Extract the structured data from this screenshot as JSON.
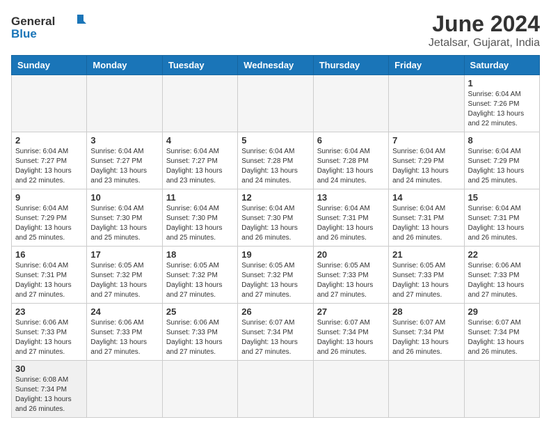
{
  "logo": {
    "general": "General",
    "blue": "Blue"
  },
  "title": "June 2024",
  "subtitle": "Jetalsar, Gujarat, India",
  "days_of_week": [
    "Sunday",
    "Monday",
    "Tuesday",
    "Wednesday",
    "Thursday",
    "Friday",
    "Saturday"
  ],
  "weeks": [
    [
      {
        "day": "",
        "info": ""
      },
      {
        "day": "",
        "info": ""
      },
      {
        "day": "",
        "info": ""
      },
      {
        "day": "",
        "info": ""
      },
      {
        "day": "",
        "info": ""
      },
      {
        "day": "",
        "info": ""
      },
      {
        "day": "1",
        "info": "Sunrise: 6:04 AM\nSunset: 7:26 PM\nDaylight: 13 hours\nand 22 minutes."
      }
    ],
    [
      {
        "day": "2",
        "info": "Sunrise: 6:04 AM\nSunset: 7:27 PM\nDaylight: 13 hours\nand 22 minutes."
      },
      {
        "day": "3",
        "info": "Sunrise: 6:04 AM\nSunset: 7:27 PM\nDaylight: 13 hours\nand 23 minutes."
      },
      {
        "day": "4",
        "info": "Sunrise: 6:04 AM\nSunset: 7:27 PM\nDaylight: 13 hours\nand 23 minutes."
      },
      {
        "day": "5",
        "info": "Sunrise: 6:04 AM\nSunset: 7:28 PM\nDaylight: 13 hours\nand 24 minutes."
      },
      {
        "day": "6",
        "info": "Sunrise: 6:04 AM\nSunset: 7:28 PM\nDaylight: 13 hours\nand 24 minutes."
      },
      {
        "day": "7",
        "info": "Sunrise: 6:04 AM\nSunset: 7:29 PM\nDaylight: 13 hours\nand 24 minutes."
      },
      {
        "day": "8",
        "info": "Sunrise: 6:04 AM\nSunset: 7:29 PM\nDaylight: 13 hours\nand 25 minutes."
      }
    ],
    [
      {
        "day": "9",
        "info": "Sunrise: 6:04 AM\nSunset: 7:29 PM\nDaylight: 13 hours\nand 25 minutes."
      },
      {
        "day": "10",
        "info": "Sunrise: 6:04 AM\nSunset: 7:30 PM\nDaylight: 13 hours\nand 25 minutes."
      },
      {
        "day": "11",
        "info": "Sunrise: 6:04 AM\nSunset: 7:30 PM\nDaylight: 13 hours\nand 25 minutes."
      },
      {
        "day": "12",
        "info": "Sunrise: 6:04 AM\nSunset: 7:30 PM\nDaylight: 13 hours\nand 26 minutes."
      },
      {
        "day": "13",
        "info": "Sunrise: 6:04 AM\nSunset: 7:31 PM\nDaylight: 13 hours\nand 26 minutes."
      },
      {
        "day": "14",
        "info": "Sunrise: 6:04 AM\nSunset: 7:31 PM\nDaylight: 13 hours\nand 26 minutes."
      },
      {
        "day": "15",
        "info": "Sunrise: 6:04 AM\nSunset: 7:31 PM\nDaylight: 13 hours\nand 26 minutes."
      }
    ],
    [
      {
        "day": "16",
        "info": "Sunrise: 6:04 AM\nSunset: 7:31 PM\nDaylight: 13 hours\nand 27 minutes."
      },
      {
        "day": "17",
        "info": "Sunrise: 6:05 AM\nSunset: 7:32 PM\nDaylight: 13 hours\nand 27 minutes."
      },
      {
        "day": "18",
        "info": "Sunrise: 6:05 AM\nSunset: 7:32 PM\nDaylight: 13 hours\nand 27 minutes."
      },
      {
        "day": "19",
        "info": "Sunrise: 6:05 AM\nSunset: 7:32 PM\nDaylight: 13 hours\nand 27 minutes."
      },
      {
        "day": "20",
        "info": "Sunrise: 6:05 AM\nSunset: 7:33 PM\nDaylight: 13 hours\nand 27 minutes."
      },
      {
        "day": "21",
        "info": "Sunrise: 6:05 AM\nSunset: 7:33 PM\nDaylight: 13 hours\nand 27 minutes."
      },
      {
        "day": "22",
        "info": "Sunrise: 6:06 AM\nSunset: 7:33 PM\nDaylight: 13 hours\nand 27 minutes."
      }
    ],
    [
      {
        "day": "23",
        "info": "Sunrise: 6:06 AM\nSunset: 7:33 PM\nDaylight: 13 hours\nand 27 minutes."
      },
      {
        "day": "24",
        "info": "Sunrise: 6:06 AM\nSunset: 7:33 PM\nDaylight: 13 hours\nand 27 minutes."
      },
      {
        "day": "25",
        "info": "Sunrise: 6:06 AM\nSunset: 7:33 PM\nDaylight: 13 hours\nand 27 minutes."
      },
      {
        "day": "26",
        "info": "Sunrise: 6:07 AM\nSunset: 7:34 PM\nDaylight: 13 hours\nand 27 minutes."
      },
      {
        "day": "27",
        "info": "Sunrise: 6:07 AM\nSunset: 7:34 PM\nDaylight: 13 hours\nand 26 minutes."
      },
      {
        "day": "28",
        "info": "Sunrise: 6:07 AM\nSunset: 7:34 PM\nDaylight: 13 hours\nand 26 minutes."
      },
      {
        "day": "29",
        "info": "Sunrise: 6:07 AM\nSunset: 7:34 PM\nDaylight: 13 hours\nand 26 minutes."
      }
    ],
    [
      {
        "day": "30",
        "info": "Sunrise: 6:08 AM\nSunset: 7:34 PM\nDaylight: 13 hours\nand 26 minutes."
      },
      {
        "day": "",
        "info": ""
      },
      {
        "day": "",
        "info": ""
      },
      {
        "day": "",
        "info": ""
      },
      {
        "day": "",
        "info": ""
      },
      {
        "day": "",
        "info": ""
      },
      {
        "day": "",
        "info": ""
      }
    ]
  ]
}
